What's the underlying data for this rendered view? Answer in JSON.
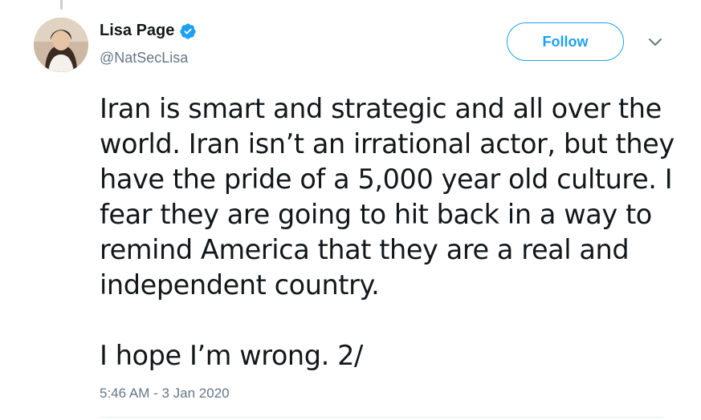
{
  "author": {
    "display_name": "Lisa Page",
    "handle": "@NatSecLisa",
    "verified": true
  },
  "follow_button": {
    "label": "Follow"
  },
  "tweet": {
    "paragraph_1": "Iran is smart and strategic and all over the world. Iran isn’t an irrational actor, but they have the pride of a 5,000 year old culture. I fear they are going to hit back in a way to remind America that they are a real and independent country.",
    "paragraph_2": "I hope I’m wrong. 2/"
  },
  "timestamp": "5:46 AM - 3 Jan 2020",
  "colors": {
    "accent": "#1da1f2",
    "secondary_text": "#657786",
    "primary_text": "#14171a"
  },
  "icons": {
    "verified": "verified-badge-icon",
    "more": "chevron-down-icon"
  }
}
